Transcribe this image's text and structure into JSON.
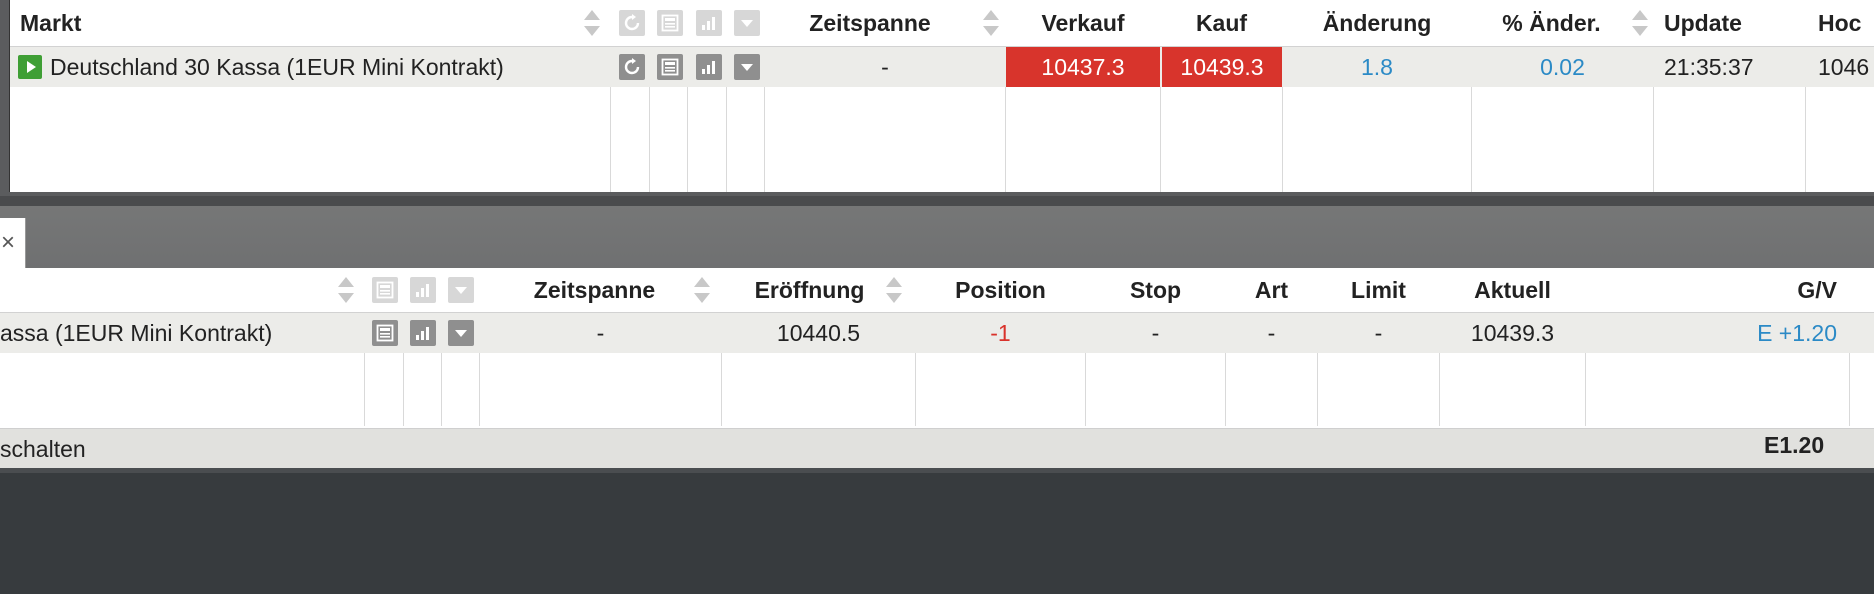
{
  "markets": {
    "headers": {
      "market": "Markt",
      "timespan": "Zeitspanne",
      "sell": "Verkauf",
      "buy": "Kauf",
      "change": "Änderung",
      "pct_change": "% Änder.",
      "update": "Update",
      "high": "Hoc"
    },
    "row": {
      "market": "Deutschland 30 Kassa (1EUR Mini Kontrakt)",
      "timespan": "-",
      "sell": "10437.3",
      "buy": "10439.3",
      "change": "1.8",
      "pct_change": "0.02",
      "update": "21:35:37",
      "high": "1046"
    }
  },
  "positions": {
    "tab_close": "×",
    "headers": {
      "timespan": "Zeitspanne",
      "opening": "Eröffnung",
      "position": "Position",
      "stop": "Stop",
      "type": "Art",
      "limit": "Limit",
      "current": "Aktuell",
      "pnl": "G/V"
    },
    "row": {
      "market": "assa (1EUR Mini Kontrakt)",
      "timespan": "-",
      "opening": "10440.5",
      "position": "-1",
      "stop": "-",
      "type": "-",
      "limit": "-",
      "current": "10439.3",
      "pnl": "E +1.20"
    },
    "footer": {
      "label": "schalten",
      "total": "E1.20"
    }
  },
  "colors": {
    "price_bg": "#d8342c",
    "positive": "#2b8ac6",
    "negative": "#d9322b",
    "play": "#3f9f35"
  },
  "icons": {
    "refresh": "refresh-icon",
    "details": "details-icon",
    "chart": "chart-icon",
    "dropdown": "dropdown-icon",
    "play": "play-icon",
    "close": "close-icon"
  }
}
